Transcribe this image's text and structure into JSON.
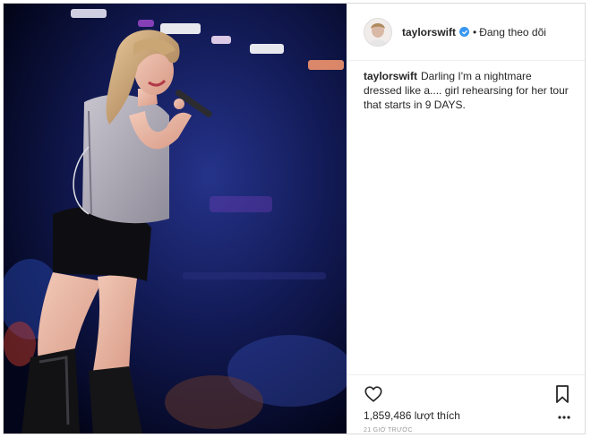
{
  "post": {
    "username": "taylorswift",
    "follow_status": "Đang theo dõi",
    "caption_user": "taylorswift",
    "caption_text": "Darling I'm a nightmare dressed like a.... girl rehearsing for her tour that starts in 9 DAYS.",
    "likes": "1,859,486 lượt thích",
    "timestamp": "21 GIỜ TRƯỚC"
  },
  "colors": {
    "verified": "#3897f0",
    "text": "#262626",
    "muted": "#999999",
    "border": "#efefef"
  },
  "icons": {
    "header": [
      "avatar",
      "verified-badge-icon"
    ],
    "actions": [
      "heart-icon",
      "bookmark-icon",
      "more-options-icon"
    ]
  }
}
